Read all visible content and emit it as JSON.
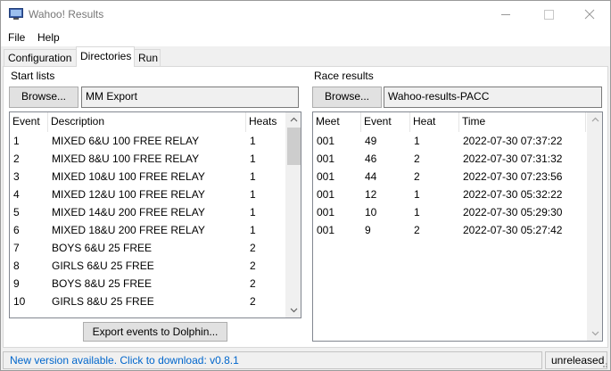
{
  "window": {
    "title": "Wahoo! Results"
  },
  "menu": [
    "File",
    "Help"
  ],
  "tabs": [
    "Configuration",
    "Directories",
    "Run"
  ],
  "start_lists": {
    "label": "Start lists",
    "browse_label": "Browse...",
    "path": "MM Export",
    "columns": [
      "Event",
      "Description",
      "Heats"
    ],
    "rows": [
      [
        "1",
        "MIXED 6&U 100 FREE RELAY",
        "1"
      ],
      [
        "2",
        "MIXED 8&U 100 FREE RELAY",
        "1"
      ],
      [
        "3",
        "MIXED 10&U 100 FREE RELAY",
        "1"
      ],
      [
        "4",
        "MIXED 12&U 100 FREE RELAY",
        "1"
      ],
      [
        "5",
        "MIXED 14&U 200 FREE RELAY",
        "1"
      ],
      [
        "6",
        "MIXED 18&U 200 FREE RELAY",
        "1"
      ],
      [
        "7",
        "BOYS 6&U 25 FREE",
        "2"
      ],
      [
        "8",
        "GIRLS 6&U 25 FREE",
        "2"
      ],
      [
        "9",
        "BOYS 8&U 25 FREE",
        "2"
      ],
      [
        "10",
        "GIRLS 8&U 25 FREE",
        "2"
      ]
    ],
    "export_label": "Export events to Dolphin..."
  },
  "race_results": {
    "label": "Race results",
    "browse_label": "Browse...",
    "path": "Wahoo-results-PACC",
    "columns": [
      "Meet",
      "Event",
      "Heat",
      "Time"
    ],
    "rows": [
      [
        "001",
        "49",
        "1",
        "2022-07-30 07:37:22"
      ],
      [
        "001",
        "46",
        "2",
        "2022-07-30 07:31:32"
      ],
      [
        "001",
        "44",
        "2",
        "2022-07-30 07:23:56"
      ],
      [
        "001",
        "12",
        "1",
        "2022-07-30 05:32:22"
      ],
      [
        "001",
        "10",
        "1",
        "2022-07-30 05:29:30"
      ],
      [
        "001",
        "9",
        "2",
        "2022-07-30 05:27:42"
      ]
    ]
  },
  "status": {
    "message": "New version available. Click to download: v0.8.1",
    "version": "unreleased"
  },
  "colors": {
    "link": "#0066cc",
    "panel": "#ffffff",
    "chrome": "#f0f0f0"
  }
}
